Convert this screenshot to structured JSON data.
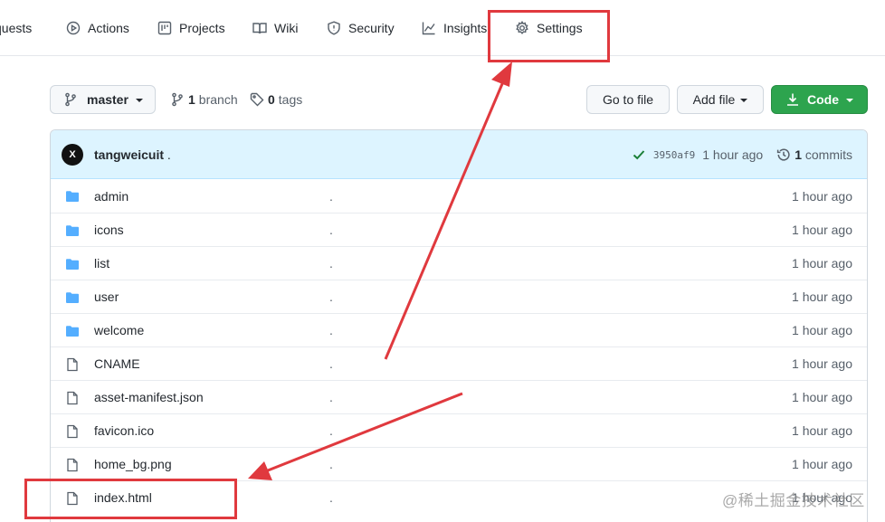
{
  "nav": {
    "pull_requests_partial": "quests",
    "actions": "Actions",
    "projects": "Projects",
    "wiki": "Wiki",
    "security": "Security",
    "insights": "Insights",
    "settings": "Settings"
  },
  "toolbar": {
    "branch": "master",
    "branches_count": "1",
    "branches_label": "branch",
    "tags_count": "0",
    "tags_label": "tags",
    "go_to_file": "Go to file",
    "add_file": "Add file",
    "code": "Code"
  },
  "commit": {
    "avatar_text": "X",
    "author": "tangweicuit",
    "message": ".",
    "sha": "3950af9",
    "time": "1 hour ago",
    "commits_count": "1",
    "commits_label": "commits"
  },
  "files": [
    {
      "type": "dir",
      "name": "admin",
      "message": ".",
      "age": "1 hour ago"
    },
    {
      "type": "dir",
      "name": "icons",
      "message": ".",
      "age": "1 hour ago"
    },
    {
      "type": "dir",
      "name": "list",
      "message": ".",
      "age": "1 hour ago"
    },
    {
      "type": "dir",
      "name": "user",
      "message": ".",
      "age": "1 hour ago"
    },
    {
      "type": "dir",
      "name": "welcome",
      "message": ".",
      "age": "1 hour ago"
    },
    {
      "type": "file",
      "name": "CNAME",
      "message": ".",
      "age": "1 hour ago"
    },
    {
      "type": "file",
      "name": "asset-manifest.json",
      "message": ".",
      "age": "1 hour ago"
    },
    {
      "type": "file",
      "name": "favicon.ico",
      "message": ".",
      "age": "1 hour ago"
    },
    {
      "type": "file",
      "name": "home_bg.png",
      "message": ".",
      "age": "1 hour ago"
    },
    {
      "type": "file",
      "name": "index.html",
      "message": ".",
      "age": "1 hour ago"
    }
  ],
  "watermark": "@稀土掘金技术社区",
  "colors": {
    "accent_green": "#2da44e",
    "folder_blue": "#54aeff",
    "annotation_red": "#e0393e",
    "commit_bar": "#ddf4ff"
  },
  "icons": {
    "actions": "play-circle-icon",
    "projects": "project-board-icon",
    "wiki": "book-icon",
    "security": "shield-icon",
    "insights": "graph-icon",
    "settings": "gear-icon",
    "branch": "git-branch-icon",
    "tag": "tag-icon",
    "code": "download-icon",
    "status": "check-icon",
    "history": "history-icon",
    "folder": "folder-icon",
    "file": "file-icon"
  }
}
